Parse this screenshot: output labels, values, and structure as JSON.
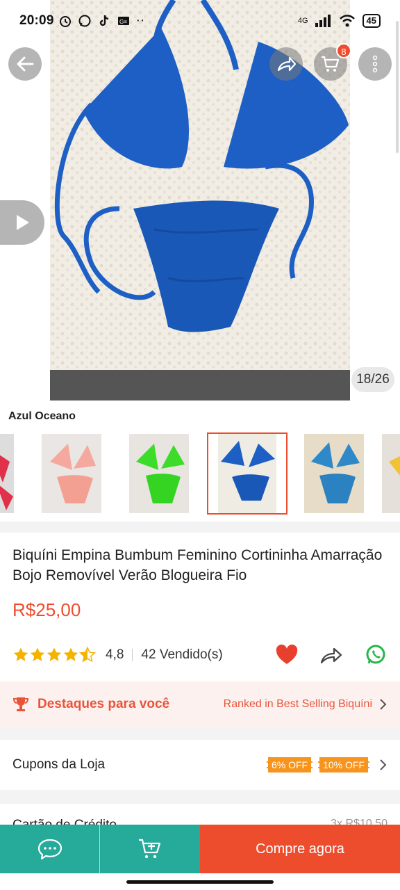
{
  "status_bar": {
    "time": "20:09",
    "network": "4G",
    "battery": "45"
  },
  "header": {
    "cart_count": "8",
    "image_counter": "18/26"
  },
  "variation": {
    "label": "Azul Oceano"
  },
  "product": {
    "title": "Biquíni Empina Bumbum Feminino Cortininha Amarração Bojo Removível Verão Blogueira Fio",
    "price": "R$25,00",
    "rating": "4,8",
    "sold": "42 Vendido(s)"
  },
  "highlight": {
    "title": "Destaques para você",
    "rank_text": "Ranked in Best Selling Biquíni"
  },
  "coupons": {
    "label": "Cupons da Loja",
    "items": [
      "6% OFF",
      "10% OFF"
    ]
  },
  "payment": {
    "label": "Cartão de Crédito",
    "value": "3x R$10,50"
  },
  "bottom_bar": {
    "buy_label": "Compre agora"
  },
  "colors": {
    "accent": "#ee4d2d",
    "teal": "#26aa99",
    "bikini_blue": "#1d5fc4"
  }
}
